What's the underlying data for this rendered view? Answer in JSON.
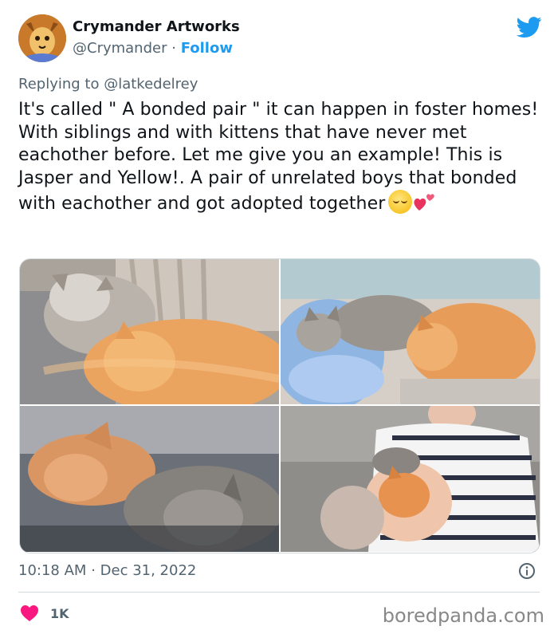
{
  "author": {
    "display_name": "Crymander Artworks",
    "handle": "@Crymander",
    "separator": "·",
    "follow_label": "Follow"
  },
  "reply": {
    "prefix": "Replying to",
    "mention": "@latkedelrey"
  },
  "tweet": {
    "text": "It's called \" A bonded pair \" it can happen in foster homes! With siblings and with kittens that have never met eachother before. Let me give you an example! This is Jasper and Yellow!. A pair of unrelated boys that bonded with eachother and got adopted together",
    "emojis": [
      "relieved-face-emoji",
      "two-hearts-emoji"
    ]
  },
  "media": {
    "photos": [
      {
        "name": "photo-kittens-on-blanket"
      },
      {
        "name": "photo-kittens-on-blue-pillow"
      },
      {
        "name": "photo-kittens-sleeping-close"
      },
      {
        "name": "photo-person-holding-kittens"
      }
    ]
  },
  "meta": {
    "time": "10:18 AM",
    "separator": "·",
    "date": "Dec 31, 2022"
  },
  "engagement": {
    "likes": "1K"
  },
  "watermark": "boredpanda.com",
  "colors": {
    "accent": "#1d9bf0",
    "like": "#f91880",
    "secondary_text": "#536471",
    "primary_text": "#0f1419"
  },
  "icons": [
    "twitter-bird-icon",
    "info-icon",
    "heart-icon"
  ]
}
